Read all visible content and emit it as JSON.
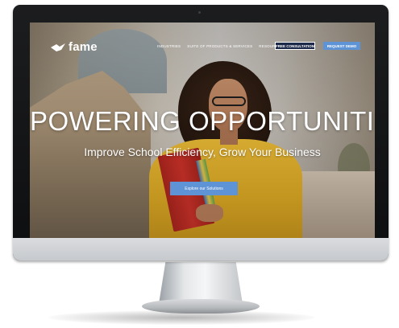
{
  "brand": {
    "name": "fame"
  },
  "nav": {
    "links": [
      "INDUSTRIES",
      "SUITE OF PRODUCTS & SERVICES",
      "RESOURCES"
    ],
    "consult_label": "FREE CONSULTATION",
    "demo_label": "REQUEST DEMO"
  },
  "hero": {
    "title": "POWERING OPPORTUNITIES",
    "subtitle": "Improve School Efficiency, Grow Your Business",
    "cta_label": "Explore our Solutions"
  },
  "colors": {
    "accent": "#5e93d6",
    "nav_button_dark": "#1e2a4a",
    "bezel": "#111214"
  },
  "icons": [
    "fame-logo-icon"
  ]
}
